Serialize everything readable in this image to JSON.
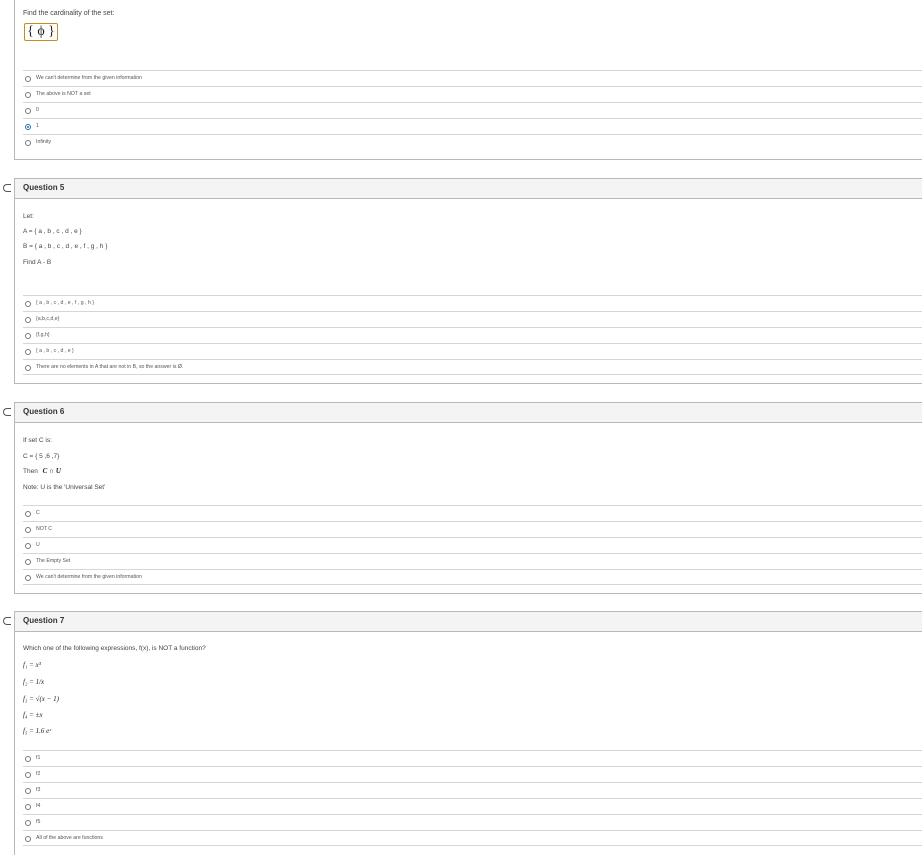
{
  "q4": {
    "prompt": "Find the cardinality of the set:",
    "set_symbol": "{ ϕ }",
    "options": [
      {
        "label": "We can't determine from the given information",
        "checked": false
      },
      {
        "label": "The above is NOT a set",
        "checked": false
      },
      {
        "label": "0",
        "checked": false
      },
      {
        "label": "1",
        "checked": true
      },
      {
        "label": "Infinity",
        "checked": false
      }
    ]
  },
  "q5": {
    "title": "Question 5",
    "line1": "Let:",
    "line2": "A = { a , b , c , d , e }",
    "line3": "B = { a , b , c , d , e , f , g , h }",
    "line4": "Find  A - B",
    "options": [
      {
        "label": "{ a , b , c , d , e , f , g , h }",
        "checked": false
      },
      {
        "label": "{a,b,c,d,e}",
        "checked": false
      },
      {
        "label": "{f,g,h}",
        "checked": false
      },
      {
        "label": "{ a , b , c , d , e }",
        "checked": false
      },
      {
        "label": "There are no elements in A that are not in B, so the answer is Ø.",
        "checked": false
      }
    ]
  },
  "q6": {
    "title": "Question 6",
    "line1": "If set C is:",
    "line2": "C = { 5 ,6 ,7}",
    "line3_prefix": "Then",
    "line3_math": "C ∩ U",
    "line4": "Note:   U  is the 'Universal Set'",
    "options": [
      {
        "label": "C",
        "checked": false
      },
      {
        "label": "NOT C",
        "checked": false
      },
      {
        "label": "U",
        "checked": false
      },
      {
        "label": "The Empty Set",
        "checked": false
      },
      {
        "label": "We can't determine from the given information",
        "checked": false
      }
    ]
  },
  "q7": {
    "title": "Question 7",
    "prompt": "Which one of the following expressions,  f(x), is NOT a function?",
    "f1": "f₁  =  x³",
    "f2": "f₂  =  1/x",
    "f3": "f₃  =  √(x − 1)",
    "f4": "f₄  =  ±x",
    "f5": "f₅  =  1.6 eˣ",
    "options": [
      {
        "label": "f1",
        "checked": false
      },
      {
        "label": "f2",
        "checked": false
      },
      {
        "label": "f3",
        "checked": false
      },
      {
        "label": "f4",
        "checked": false
      },
      {
        "label": "f5",
        "checked": false
      },
      {
        "label": "All of the above are functions",
        "checked": false
      }
    ]
  }
}
